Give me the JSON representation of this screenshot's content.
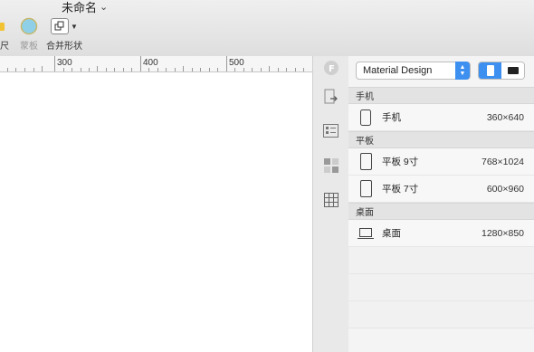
{
  "toolbar": {
    "doc_title": "未命名",
    "tools": {
      "ruler_label": "标尺",
      "mask_label": "蒙板",
      "merge_label": "合并形状"
    }
  },
  "ruler": {
    "marks": [
      "300",
      "400",
      "500"
    ]
  },
  "panel": {
    "preset_select": "Material Design",
    "orientation": {
      "selected": "portrait"
    },
    "sections": [
      {
        "label": "手机",
        "devices": [
          {
            "name": "手机",
            "size": "360×640",
            "type": "phone"
          }
        ]
      },
      {
        "label": "平板",
        "devices": [
          {
            "name": "平板 9寸",
            "size": "768×1024",
            "type": "tablet"
          },
          {
            "name": "平板 7寸",
            "size": "600×960",
            "type": "tablet"
          }
        ]
      },
      {
        "label": "桌面",
        "devices": [
          {
            "name": "桌面",
            "size": "1280×850",
            "type": "desktop"
          }
        ]
      }
    ]
  },
  "colors": {
    "accent": "#3d8ff0",
    "mask_icon": "#8fd0e8"
  },
  "icons": [
    "folder-icon",
    "mask-icon",
    "merge-shapes-icon",
    "chevron-down-icon",
    "font-icon",
    "export-icon",
    "properties-icon",
    "components-icon",
    "grid-icon",
    "phone-icon",
    "tablet-icon",
    "laptop-icon",
    "portrait-icon",
    "landscape-icon"
  ]
}
